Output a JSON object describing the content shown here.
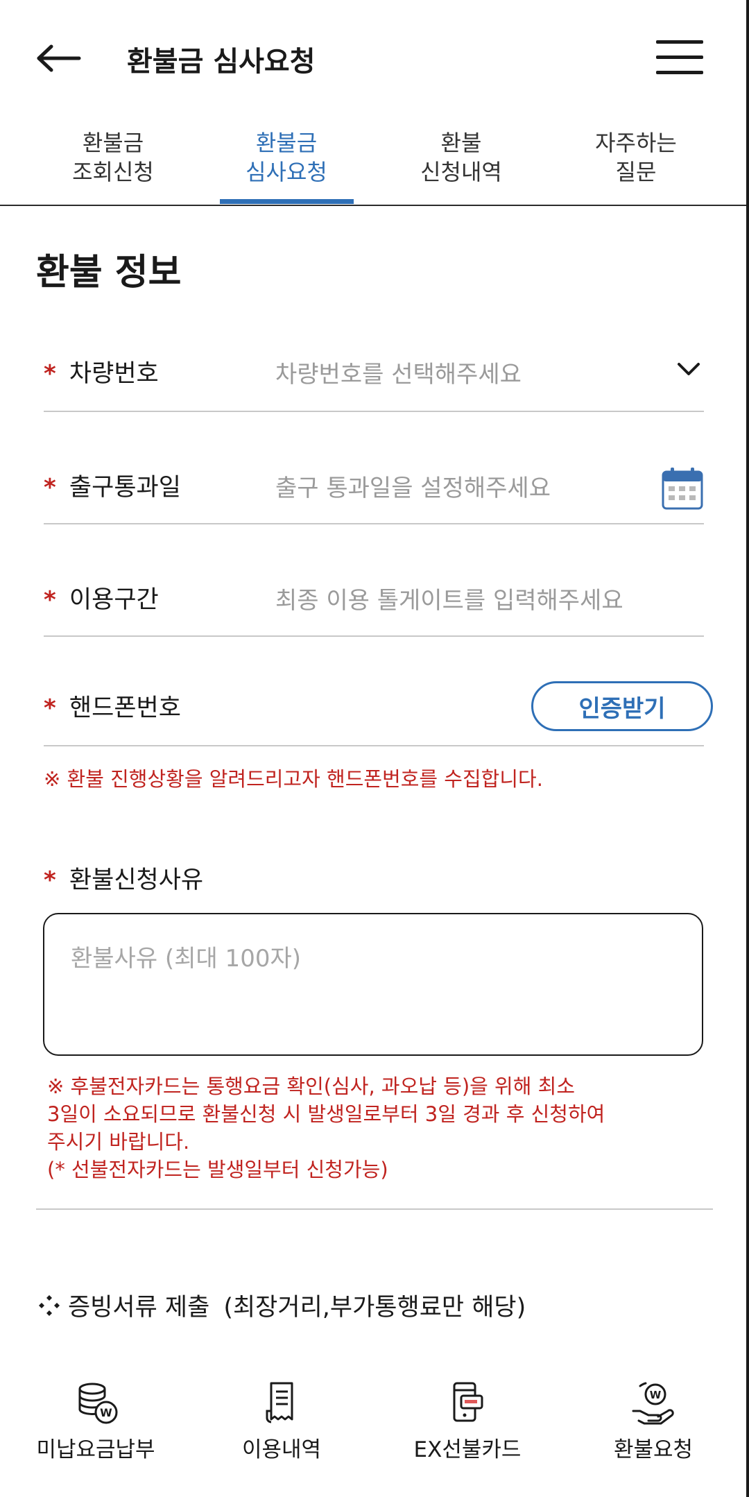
{
  "header": {
    "title": "환불금 심사요청"
  },
  "tabs": [
    {
      "line1": "환불금",
      "line2": "조회신청"
    },
    {
      "line1": "환불금",
      "line2": "심사요청"
    },
    {
      "line1": "환불",
      "line2": "신청내역"
    },
    {
      "line1": "자주하는",
      "line2": "질문"
    }
  ],
  "active_tab_index": 1,
  "section": {
    "title": "환불 정보"
  },
  "form": {
    "required_mark": "*",
    "vehicle": {
      "label": "차량번호",
      "placeholder": "차량번호를 선택해주세요"
    },
    "exit_date": {
      "label": "출구통과일",
      "placeholder": "출구 통과일을 설정해주세요"
    },
    "section_used": {
      "label": "이용구간",
      "placeholder": "최종 이용 톨게이트를 입력해주세요"
    },
    "phone": {
      "label": "핸드폰번호",
      "button_label": "인증받기"
    },
    "phone_notice": "※ 환불 진행상황을 알려드리고자 핸드폰번호를 수집합니다.",
    "reason": {
      "label": "환불신청사유",
      "placeholder": "환불사유 (최대 100자)"
    },
    "card_notice": [
      "※ 후불전자카드는 통행요금 확인(심사, 과오납 등)을 위해 최소",
      "3일이 소요되므로 환불신청 시 발생일로부터 3일 경과 후 신청하여",
      "주시기 바랍니다.",
      "(* 선불전자카드는 발생일부터 신청가능)"
    ]
  },
  "evidence": {
    "title": "증빙서류 제출",
    "note": "(최장거리,부가통행료만 해당)"
  },
  "bottom_nav": [
    {
      "label": "미납요금납부",
      "icon": "coin-stack-icon"
    },
    {
      "label": "이용내역",
      "icon": "receipt-icon"
    },
    {
      "label": "EX선불카드",
      "icon": "prepaid-card-icon"
    },
    {
      "label": "환불요청",
      "icon": "refund-hand-icon"
    }
  ],
  "colors": {
    "accent": "#2e6fb6",
    "required": "#c0231f",
    "placeholder": "#9a9a9a"
  }
}
